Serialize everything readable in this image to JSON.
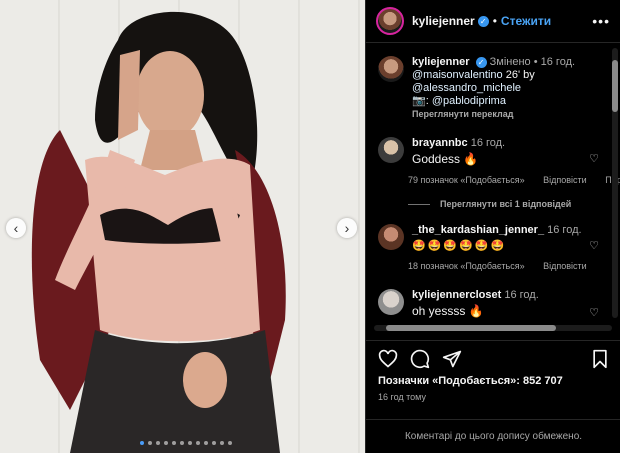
{
  "post": {
    "author": "kyliejenner",
    "follow_label": "Стежити",
    "separator": "•",
    "more_label": "•••"
  },
  "caption": {
    "author": "kyliejenner",
    "edited": "Змінено",
    "time": "16 год.",
    "line1_mention": "@maisonvalentino",
    "line1_rest": " 26' by",
    "line2_mention": "@alessandro_michele",
    "line3_prefix": "📷: ",
    "line3_mention": "@pablodiprima",
    "translate_label": "Переглянути переклад"
  },
  "comments": [
    {
      "user": "brayannbc",
      "time": "16 год.",
      "text": "Goddess 🔥",
      "likes": "79 позначок «Подобається»",
      "reply_label": "Відповісти",
      "extra_label": "Пере",
      "view_replies": "Переглянути всі 1 відповідей"
    },
    {
      "user": "_the_kardashian_jenner_",
      "time": "16 год.",
      "text": "🤩🤩🤩🤩🤩🤩",
      "likes": "18 позначок «Подобається»",
      "reply_label": "Відповісти"
    },
    {
      "user": "kyliejennercloset",
      "time": "16 год.",
      "text": "oh yessss 🔥"
    }
  ],
  "footer": {
    "likes_label": "Позначки «Подобається»: 852 707",
    "time_ago": "16 год тому",
    "comments_restricted": "Коментарі до цього допису обмежено."
  },
  "carousel": {
    "prev": "‹",
    "next": "›",
    "total_slides": 12,
    "active_slide": 1
  },
  "icons": {
    "like": "heart-icon",
    "comment": "comment-icon",
    "share": "share-icon",
    "save": "bookmark-icon"
  },
  "colors": {
    "accent": "#4aa3f4",
    "verified": "#3897f0",
    "background": "#000000"
  }
}
